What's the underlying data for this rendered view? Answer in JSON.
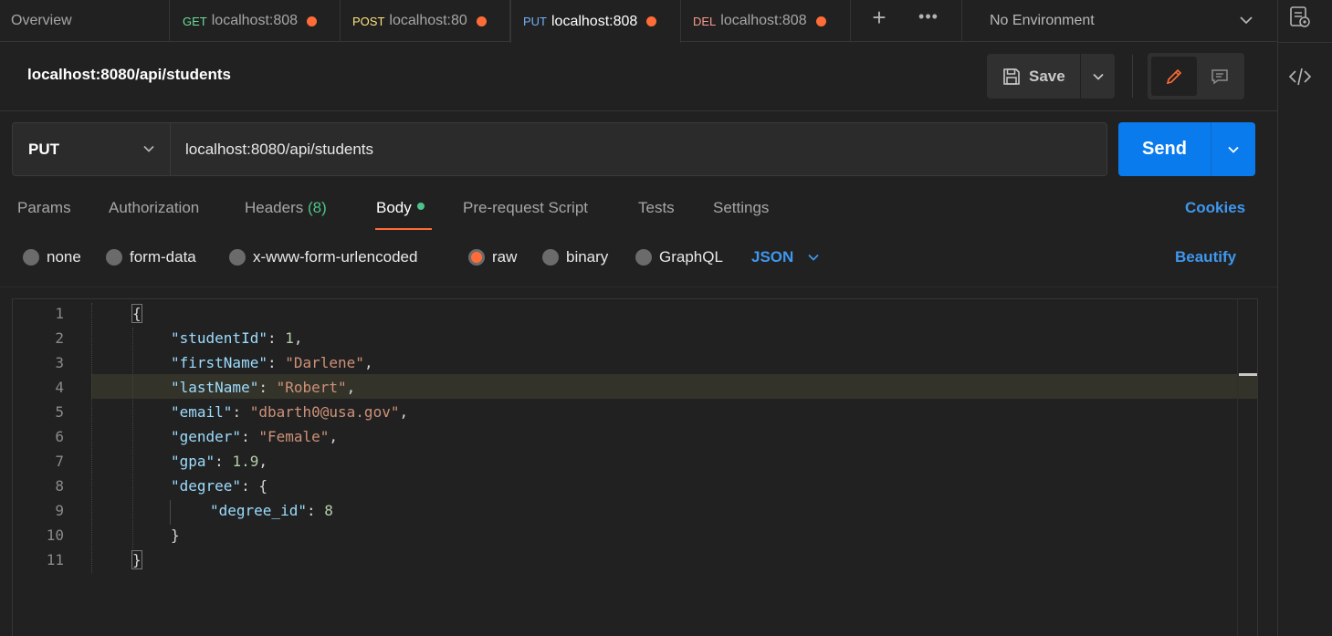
{
  "tabs": {
    "overview": "Overview",
    "items": [
      {
        "method": "GET",
        "label": "localhost:808"
      },
      {
        "method": "POST",
        "label": "localhost:80"
      },
      {
        "method": "PUT",
        "label": "localhost:808"
      },
      {
        "method": "DEL",
        "label": "localhost:808"
      }
    ],
    "plus": "+",
    "more": "•••"
  },
  "environment": {
    "label": "No Environment"
  },
  "request": {
    "title": "localhost:8080/api/students",
    "save_label": "Save",
    "method": "PUT",
    "url": "localhost:8080/api/students",
    "send_label": "Send"
  },
  "request_tabs": {
    "params": "Params",
    "authorization": "Authorization",
    "headers": "Headers",
    "headers_count": "(8)",
    "body": "Body",
    "prerequest": "Pre-request Script",
    "tests": "Tests",
    "settings": "Settings",
    "cookies": "Cookies"
  },
  "body_types": {
    "none": "none",
    "form_data": "form-data",
    "urlencoded": "x-www-form-urlencoded",
    "raw": "raw",
    "binary": "binary",
    "graphql": "GraphQL",
    "format": "JSON",
    "beautify": "Beautify"
  },
  "editor": {
    "line_numbers": [
      "1",
      "2",
      "3",
      "4",
      "5",
      "6",
      "7",
      "8",
      "9",
      "10",
      "11"
    ],
    "lines": {
      "l1": "{",
      "k_studentId": "\"studentId\"",
      "v_studentId": "1",
      "k_firstName": "\"firstName\"",
      "v_firstName": "\"Darlene\"",
      "k_lastName": "\"lastName\"",
      "v_lastName": "\"Robert\"",
      "k_email": "\"email\"",
      "v_email": "\"dbarth0@usa.gov\"",
      "k_gender": "\"gender\"",
      "v_gender": "\"Female\"",
      "k_gpa": "\"gpa\"",
      "v_gpa": "1.9",
      "k_degree": "\"degree\"",
      "v_degree_open": "{",
      "k_degree_id": "\"degree_id\"",
      "v_degree_id": "8",
      "l10": "}",
      "l11": "}"
    }
  },
  "colors": {
    "accent": "#ff6c37",
    "send": "#097bed",
    "link": "#3f97ee",
    "count": "#4cc38a"
  }
}
